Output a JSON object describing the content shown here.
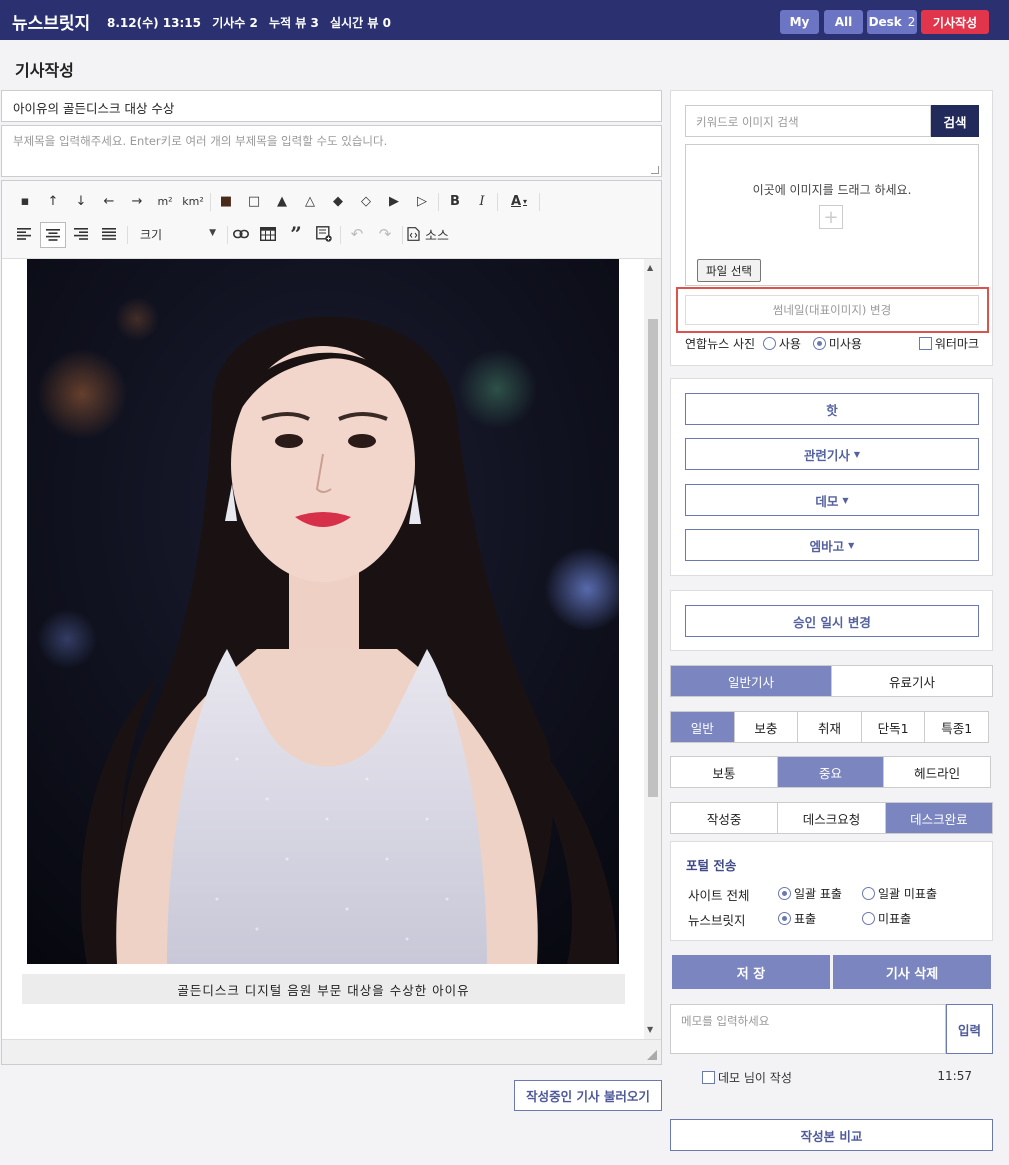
{
  "header": {
    "brand": "뉴스브릿지",
    "date": "8.12(수) 13:15",
    "article_count": "기사수 2",
    "total_views": "누적 뷰 3",
    "realtime_views": "실시간 뷰 0",
    "my_label": "My",
    "all_label": "All",
    "desk_label": "Desk",
    "desk_count": "2",
    "write_label": "기사작성"
  },
  "page": {
    "title": "기사작성"
  },
  "article": {
    "title_value": "아이유의 골든디스크 대상 수상",
    "subtitle_placeholder": "부제목을 입력해주세요. Enter키로 여러 개의 부제목을 입력할 수도 있습니다."
  },
  "toolbar": {
    "row1": [
      "▪",
      "↑",
      "↓",
      "←",
      "→",
      "m²",
      "km²",
      "■",
      "□",
      "▲",
      "△",
      "◆",
      "◇",
      "▶",
      "▷",
      "B",
      "I",
      "A"
    ],
    "size_label": "크기",
    "source_label": "소스"
  },
  "content": {
    "caption": "골든디스크 디지털 음원 부문 대상을 수상한 아이유"
  },
  "load_draft_label": "작성중인 기사 불러오기",
  "image_panel": {
    "search_placeholder": "키워드로 이미지 검색",
    "search_label": "검색",
    "drop_text": "이곳에 이미지를 드래그 하세요.",
    "file_select_label": "파일 선택",
    "thumbnail_label": "썸네일(대표이미지) 변경",
    "yonhap_label": "연합뉴스 사진",
    "use_label": "사용",
    "nouse_label": "미사용",
    "watermark_label": "워터마크"
  },
  "actions": {
    "hot": "핫",
    "related": "관련기사",
    "demo": "데모",
    "embargo": "엠바고",
    "approval": "승인 일시 변경"
  },
  "article_type": [
    "일반기사",
    "유료기사"
  ],
  "category": [
    "일반",
    "보충",
    "취재",
    "단독1",
    "특종1"
  ],
  "importance": [
    "보통",
    "중요",
    "헤드라인"
  ],
  "status": [
    "작성중",
    "데스크요청",
    "데스크완료"
  ],
  "portal": {
    "title": "포털 전송",
    "site_label": "사이트 전체",
    "site_show": "일괄 표출",
    "site_hide": "일괄 미표출",
    "nb_label": "뉴스브릿지",
    "nb_show": "표출",
    "nb_hide": "미표출"
  },
  "save_label": "저 장",
  "delete_label": "기사 삭제",
  "memo": {
    "placeholder": "메모를 입력하세요",
    "submit_label": "입력",
    "item_text": "데모 님이 작성",
    "item_time": "11:57"
  },
  "compare_label": "작성본 비교",
  "colors": {
    "header_bg": "#2a3070",
    "accent": "#7b86c0",
    "danger": "#e0354b",
    "highlight": "#d9534f"
  }
}
